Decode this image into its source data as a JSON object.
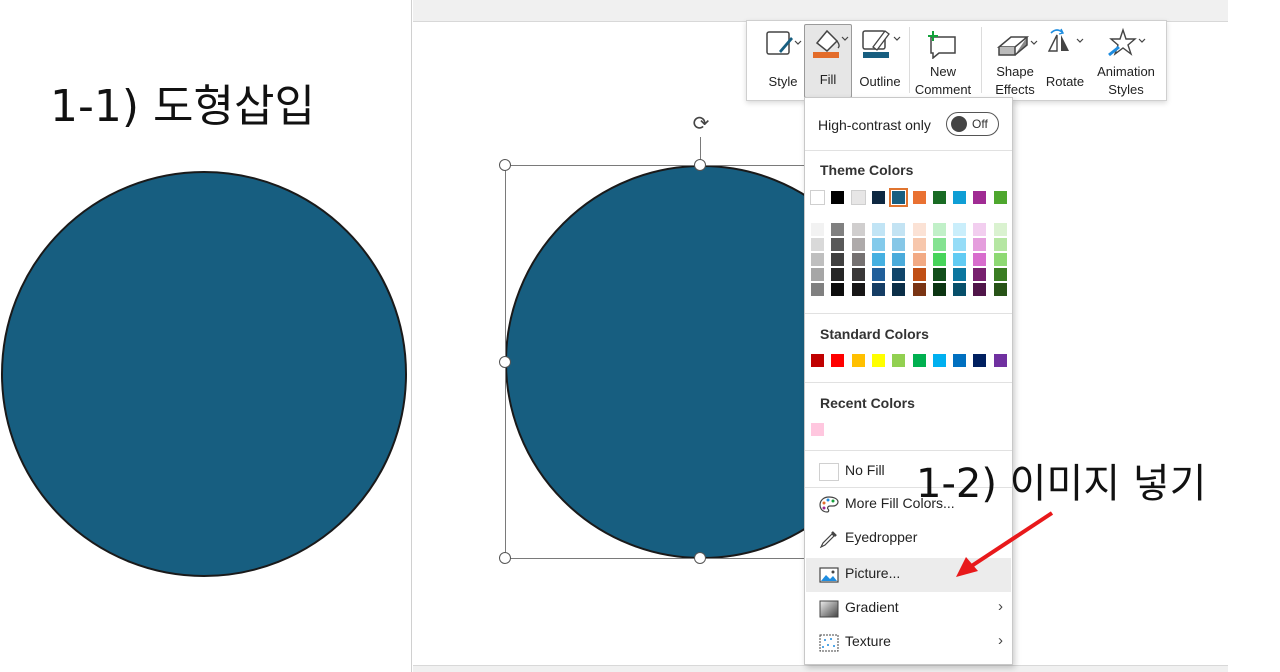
{
  "left_panel": {
    "title": "1-1) 도형삽입",
    "shape_fill": "#175e80"
  },
  "annotation": {
    "text": "1-2) 이미지 넣기",
    "arrow_color": "#e8191b"
  },
  "toolbar": {
    "style_label": "Style",
    "fill_label": "Fill",
    "outline_label": "Outline",
    "new_comment_line1": "New",
    "new_comment_line2": "Comment",
    "shape_effects_line1": "Shape",
    "shape_effects_line2": "Effects",
    "rotate_label": "Rotate",
    "animation_styles_line1": "Animation",
    "animation_styles_line2": "Styles",
    "fill_accent_color": "#e36c2a",
    "outline_accent_color": "#175e80"
  },
  "fill_menu": {
    "high_contrast_label": "High-contrast only",
    "toggle_state": "Off",
    "theme_colors_header": "Theme Colors",
    "theme_colors": [
      "#ffffff",
      "#000000",
      "#e7e6e6",
      "#0e2841",
      "#175e80",
      "#e97132",
      "#196b24",
      "#0f9ed5",
      "#a02b93",
      "#4ea72e"
    ],
    "theme_selected_index": 4,
    "theme_shades": [
      [
        "#f2f2f2",
        "#d9d9d9",
        "#bfbfbf",
        "#a6a6a6",
        "#808080"
      ],
      [
        "#808080",
        "#595959",
        "#404040",
        "#262626",
        "#0d0d0d"
      ],
      [
        "#d0cece",
        "#aeaaaa",
        "#757171",
        "#3a3838",
        "#171616"
      ],
      [
        "#c1e4f5",
        "#83caeb",
        "#45b0e1",
        "#215f9a",
        "#153d64"
      ],
      [
        "#c3e3f3",
        "#86c7e7",
        "#4aabdb",
        "#10456a",
        "#0b2e47"
      ],
      [
        "#fbe2d5",
        "#f7c7ac",
        "#f2aa84",
        "#c04f15",
        "#7a3413"
      ],
      [
        "#c1f0c8",
        "#84e291",
        "#47d45a",
        "#124f1b",
        "#0c3512"
      ],
      [
        "#caeefb",
        "#95dcf7",
        "#61cbf3",
        "#0b769f",
        "#074f6a"
      ],
      [
        "#f2ceef",
        "#e59edd",
        "#d86dcd",
        "#78206e",
        "#501549"
      ],
      [
        "#daf2d0",
        "#b5e6a2",
        "#8ed973",
        "#3a7d22",
        "#275317"
      ]
    ],
    "standard_colors_header": "Standard Colors",
    "standard_colors": [
      "#c00000",
      "#ff0000",
      "#ffc000",
      "#ffff00",
      "#92d050",
      "#00b050",
      "#00b0f0",
      "#0070c0",
      "#002060",
      "#7030a0"
    ],
    "recent_colors_header": "Recent Colors",
    "recent_colors": [
      "#ffc7df"
    ],
    "no_fill_label": "No Fill",
    "more_fill_colors_label": "More Fill Colors...",
    "eyedropper_label": "Eyedropper",
    "picture_label": "Picture...",
    "gradient_label": "Gradient",
    "texture_label": "Texture"
  }
}
